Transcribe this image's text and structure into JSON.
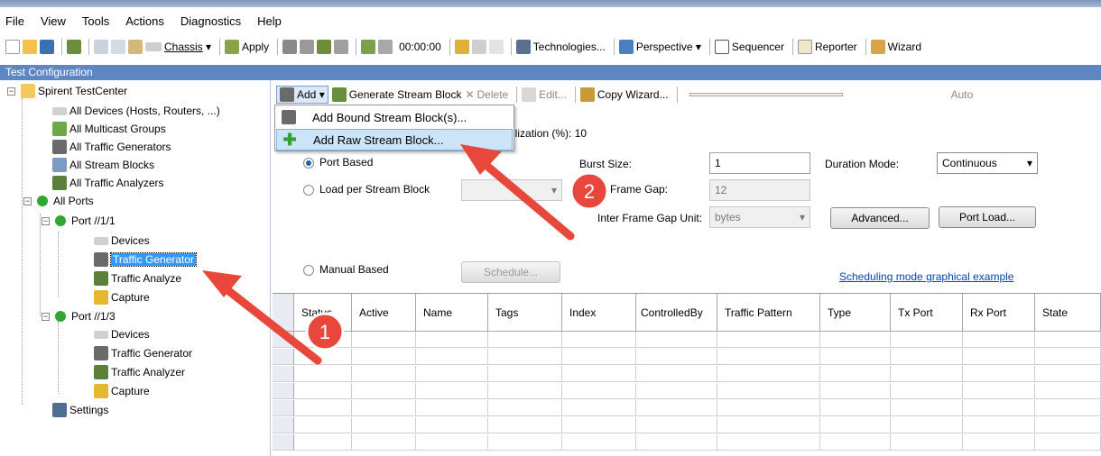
{
  "menubar": {
    "items": [
      "File",
      "View",
      "Tools",
      "Actions",
      "Diagnostics",
      "Help"
    ]
  },
  "toolbar": {
    "chassis": "Chassis",
    "apply": "Apply",
    "time": "00:00:00",
    "technologies": "Technologies...",
    "perspective": "Perspective",
    "sequencer": "Sequencer",
    "reporter": "Reporter",
    "wizard": "Wizard"
  },
  "panel_title": "Test Configuration",
  "tree": {
    "root": "Spirent TestCenter",
    "all_devices": "All Devices (Hosts, Routers, ...)",
    "all_multicast": "All Multicast Groups",
    "all_traffic_generators": "All Traffic Generators",
    "all_stream_blocks": "All Stream Blocks",
    "all_traffic_analyzers": "All Traffic Analyzers",
    "all_ports": "All Ports",
    "port1": "Port //1/1",
    "port1_devices": "Devices",
    "port1_generator": "Traffic Generator",
    "port1_analyzer": "Traffic Analyze",
    "port1_capture": "Capture",
    "port3": "Port //1/3",
    "port3_devices": "Devices",
    "port3_generator": "Traffic Generator",
    "port3_analyzer": "Traffic Analyzer",
    "port3_capture": "Capture",
    "settings": "Settings"
  },
  "subtoolbar": {
    "add": "Add",
    "generate": "Generate Stream Block",
    "delete": "Delete",
    "edit": "Edit...",
    "copy_wizard": "Copy Wizard...",
    "auto": "Auto"
  },
  "dropdown": {
    "bound": "Add Bound Stream Block(s)...",
    "raw": "Add Raw Stream Block..."
  },
  "form": {
    "bandwidth": "dth Utilization (%): 10",
    "port_based": "Port Based",
    "load_per_stream": "Load per Stream Block",
    "manual_based": "Manual Based",
    "schedule": "Schedule...",
    "burst_size_label": "Burst Size:",
    "burst_size_value": "1",
    "frame_gap_label": "Frame Gap:",
    "frame_gap_value": "12",
    "gap_unit_label": "Inter Frame Gap Unit:",
    "gap_unit_value": "bytes",
    "duration_label": "Duration Mode:",
    "duration_value": "Continuous",
    "advanced": "Advanced...",
    "port_load": "Port Load...",
    "link": "Scheduling mode graphical example"
  },
  "grid": {
    "columns": [
      "Status",
      "Active",
      "Name",
      "Tags",
      "Index",
      "ControlledBy",
      "Traffic Pattern",
      "Type",
      "Tx Port",
      "Rx Port",
      "State"
    ]
  },
  "annotations": {
    "step1": "1",
    "step2": "2",
    "arrow_color": "#e8483c"
  }
}
